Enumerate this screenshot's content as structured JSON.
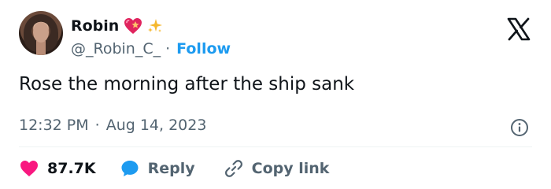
{
  "author": {
    "display_name": "Robin",
    "handle": "@_Robin_C_",
    "separator": "·",
    "follow_label": "Follow"
  },
  "tweet": {
    "text": "Rose the morning after the ship sank",
    "time": "12:32 PM",
    "separator": "·",
    "date": "Aug 14, 2023"
  },
  "actions": {
    "likes_count": "87.7K",
    "reply_label": "Reply",
    "copy_label": "Copy link"
  },
  "colors": {
    "like_pink": "#f91880",
    "reply_blue": "#1d9bf0",
    "follow_blue": "#1d9bf0",
    "muted_text": "#536471",
    "divider": "#eff3f4"
  },
  "icons": [
    "heart-emoji-icon",
    "sparkles-emoji-icon",
    "x-logo-icon",
    "info-icon",
    "like-heart-icon",
    "reply-bubble-icon",
    "link-icon"
  ]
}
